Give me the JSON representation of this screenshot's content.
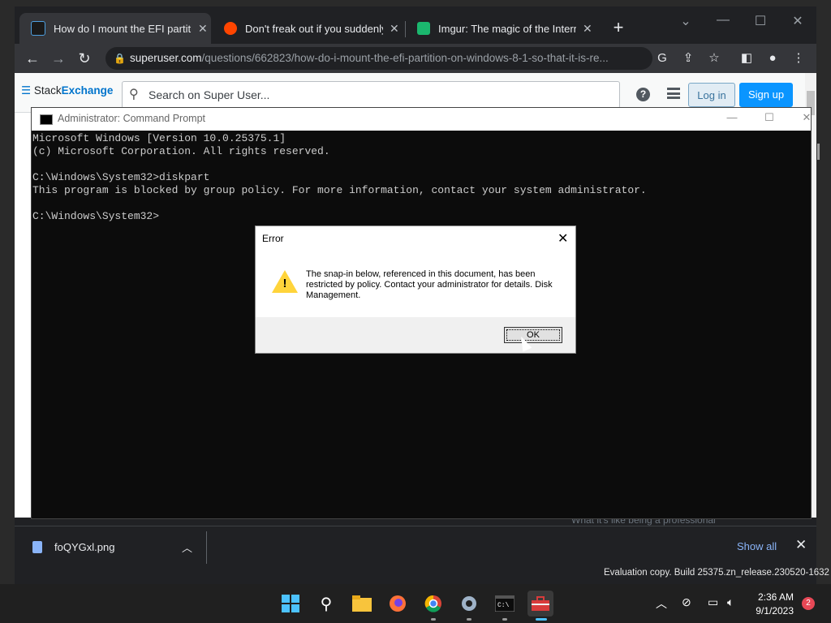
{
  "browser": {
    "tabs": [
      {
        "title": "How do I mount the EFI partitio",
        "favicon": "stackexchange-icon"
      },
      {
        "title": "Don't freak out if you suddenly c",
        "favicon": "reddit-icon"
      },
      {
        "title": "Imgur: The magic of the Internet",
        "favicon": "imgur-icon"
      }
    ],
    "url_host": "superuser.com",
    "url_path": "/questions/662823/how-do-i-mount-the-efi-partition-on-windows-8-1-so-that-it-is-re..."
  },
  "site": {
    "logo_plain": "Stack",
    "logo_bold": "Exchange",
    "search_placeholder": "Search on Super User...",
    "login_label": "Log in",
    "signup_label": "Sign up",
    "bottom_text": "What it's like being a professional"
  },
  "downloads": {
    "file_name": "foQYGxl.png",
    "show_all_label": "Show all"
  },
  "cmd": {
    "title": "Administrator: Command Prompt",
    "lines": [
      "Microsoft Windows [Version 10.0.25375.1]",
      "(c) Microsoft Corporation. All rights reserved.",
      "",
      "C:\\Windows\\System32>diskpart",
      "This program is blocked by group policy. For more information, contact your system administrator.",
      "",
      "C:\\Windows\\System32>"
    ]
  },
  "dialog": {
    "title": "Error",
    "message": "The snap-in below, referenced in this document, has been restricted by policy. Contact your administrator for details. Disk Management.",
    "ok_label": "OK"
  },
  "watermark": "Evaluation copy. Build 25375.zn_release.230520-1632",
  "taskbar": {
    "time": "2:36 AM",
    "date": "9/1/2023",
    "notification_count": "2"
  },
  "colors": {
    "chrome_dark": "#202124",
    "cmd_background": "#0c0c0c",
    "signup_blue": "#0a95ff",
    "notification_red": "#e74856"
  }
}
